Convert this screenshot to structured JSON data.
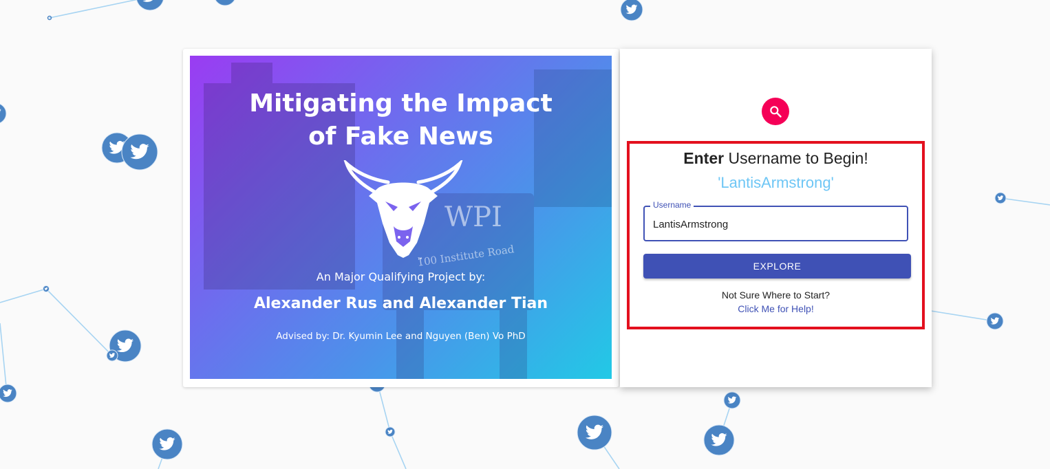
{
  "banner": {
    "title_line1": "Mitigating the Impact",
    "title_line2": "of Fake News",
    "subtitle": "An Major Qualifying Project by:",
    "authors": "Alexander Rus and Alexander Tian",
    "advisors": "Advised by: Dr. Kyumin Lee and Nguyen (Ben) Vo PhD",
    "trademark": "™",
    "photo_sign": "WPI",
    "photo_address": "100 Institute Road"
  },
  "login": {
    "heading_bold": "Enter",
    "heading_rest": " Username to Begin!",
    "current_username": "'LantisArmstrong'",
    "field_label": "Username",
    "field_value": "LantisArmstrong",
    "explore_label": "EXPLORE",
    "help_question": "Not Sure Where to Start?",
    "help_link": "Click Me for Help!"
  },
  "icons": {
    "avatar": "search-icon",
    "nodes": "twitter-bird-icon",
    "logo": "goat-logo"
  },
  "colors": {
    "primary": "#3f51b5",
    "accent": "#f50057",
    "highlight": "#e3101e",
    "username_text": "#6ec6f5",
    "node": "#4a84c4",
    "edge": "#a7d4f2"
  }
}
